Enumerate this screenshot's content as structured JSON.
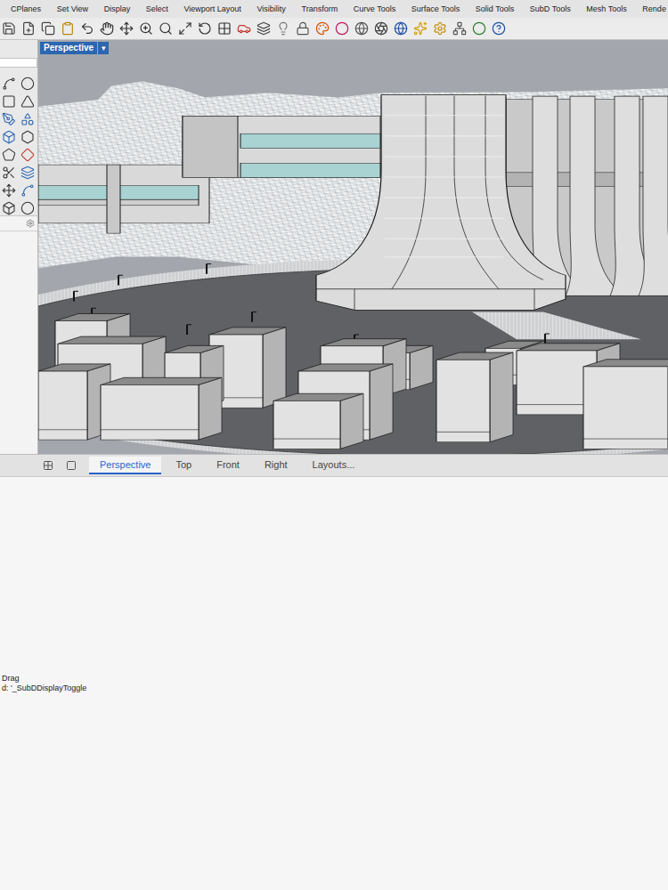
{
  "menu_tabs": [
    "CPlanes",
    "Set View",
    "Display",
    "Select",
    "Viewport Layout",
    "Visibility",
    "Transform",
    "Curve Tools",
    "Surface Tools",
    "Solid Tools",
    "SubD Tools",
    "Mesh Tools",
    "Rende"
  ],
  "viewport": {
    "label": "Perspective",
    "dropdown": "▾"
  },
  "view_tabs": [
    {
      "label": "Perspective",
      "selected": true
    },
    {
      "label": "Top",
      "selected": false
    },
    {
      "label": "Front",
      "selected": false
    },
    {
      "label": "Right",
      "selected": false
    },
    {
      "label": "Layouts...",
      "selected": false
    }
  ],
  "command_history": [
    "Drag",
    "d: '_SubDDisplayToggle"
  ]
}
